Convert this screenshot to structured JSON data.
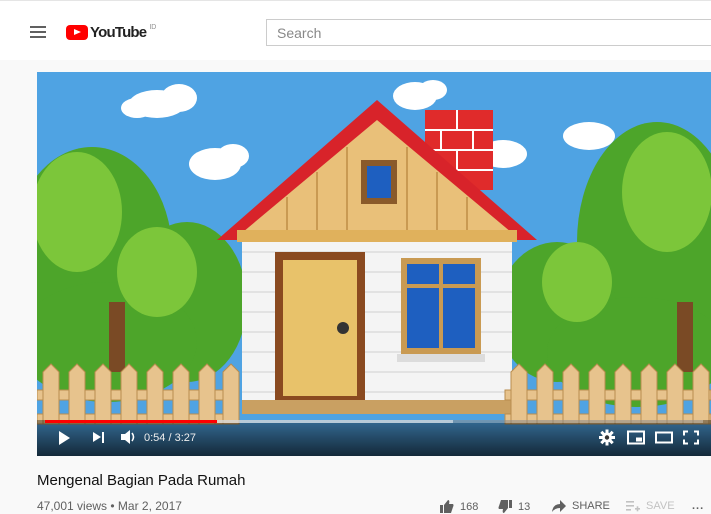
{
  "header": {
    "logo_text": "YouTube",
    "logo_region": "ID",
    "search_placeholder": "Search"
  },
  "player": {
    "time_current": "0:54",
    "time_total": "3:27",
    "time_display": "0:54 / 3:27",
    "progress_fraction": 0.261,
    "buffer_fraction": 0.62
  },
  "video": {
    "title": "Mengenal Bagian Pada Rumah",
    "meta": "47,001 views • Mar 2, 2017",
    "likes": "168",
    "dislikes": "13",
    "share_label": "SHARE",
    "save_label": "SAVE",
    "more_label": "..."
  },
  "colors": {
    "brand_red": "#ff0000",
    "sky": "#5aa9e6",
    "roof": "#d8232a",
    "door": "#e8c26a"
  },
  "icons": [
    "menu-icon",
    "youtube-logo-icon",
    "play-icon",
    "next-icon",
    "volume-icon",
    "settings-icon",
    "miniplayer-icon",
    "theater-icon",
    "fullscreen-icon",
    "thumbs-up-icon",
    "thumbs-down-icon",
    "share-icon",
    "save-icon",
    "more-icon"
  ]
}
